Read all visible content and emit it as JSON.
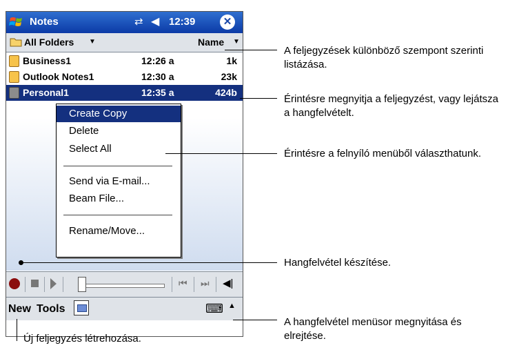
{
  "device": {
    "app_title": "Notes",
    "clock": "12:39",
    "status_icons": [
      "connectivity-icon",
      "volume-icon",
      "close-icon"
    ],
    "start_icon": "windows-flag-icon"
  },
  "folderbar": {
    "folder": "All Folders",
    "sort": "Name"
  },
  "notes": [
    {
      "name": "Business1",
      "time": "12:26 a",
      "size": "1k",
      "selected": false
    },
    {
      "name": "Outlook Notes1",
      "time": "12:30 a",
      "size": "23k",
      "selected": false
    },
    {
      "name": "Personal1",
      "time": "12:35 a",
      "size": "424b",
      "selected": true
    }
  ],
  "context_menu": [
    "Create Copy",
    "Delete",
    "Select All",
    "Send via E-mail...",
    "Beam File...",
    "Rename/Move..."
  ],
  "recording_toolbar": {
    "icons": [
      "record-icon",
      "stop-icon",
      "play-icon",
      "slider",
      "previous-icon",
      "next-icon",
      "speaker-icon"
    ]
  },
  "command_bar": {
    "new": "New",
    "tools": "Tools",
    "icons": [
      "recording-toolbar-icon",
      "keyboard-icon",
      "sip-caret-icon"
    ]
  },
  "callouts": {
    "sort": "A feljegyzések különböző szempont szerinti listázása.",
    "open": "Érintésre megnyitja a feljegyzést, vagy lejátsza a hangfelvételt.",
    "popup": "Érintésre a felnyíló menüből választhatunk.",
    "record": "Hangfelvétel készítése.",
    "toggle": "A hangfelvétel menüsor megnyitása és elrejtése.",
    "new_note": "Új feljegyzés létrehozása."
  }
}
